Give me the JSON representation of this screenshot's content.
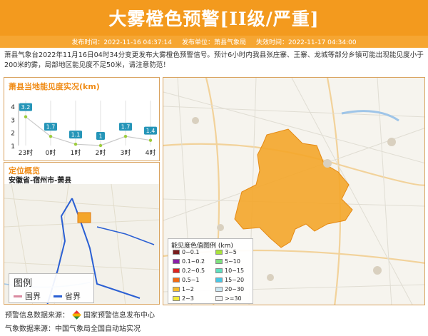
{
  "header": {
    "title": "大雾橙色预警[II级/严重]"
  },
  "meta": {
    "publish_time": "发布时间：2022-11-16 04:37:14",
    "publisher": "发布单位：萧县气象局",
    "expire_time": "失效时间：2022-11-17 04:34:00"
  },
  "intro": "萧县气象台2022年11月16日04时34分变更发布大雾橙色预警信号。预计6小时内我县张庄寨、王寨、龙城等部分乡镇可能出现能见度小于200米的雾，局部地区能见度不足50米，请注意防范！",
  "visibility": {
    "title": "萧县当地能见度实况(km)",
    "y_ticks": [
      "4",
      "3",
      "2",
      "1"
    ],
    "chart_data": {
      "type": "line",
      "categories": [
        "23时",
        "0时",
        "1时",
        "2时",
        "3时",
        "4时"
      ],
      "values": [
        3.2,
        1.7,
        1.1,
        1.0,
        1.7,
        1.4
      ],
      "labels": [
        "3.2",
        "1.7",
        "1.1",
        "1",
        "1.7",
        "1.4"
      ],
      "ylim": [
        1,
        4
      ],
      "line_color": "#c9c9c9",
      "point_color": "#9ccc3c",
      "label_color": "#2595b8"
    }
  },
  "location": {
    "title": "定位概览",
    "path": "安徽省-宿州市-萧县",
    "legend_title": "图例",
    "legend_country": "国界",
    "legend_province": "省界",
    "country_color": "#d98aa0",
    "province_color": "#2a5fd3"
  },
  "map_legend": {
    "title": "能见度色值图例 (km)",
    "items": [
      {
        "label": "0~0.1",
        "color": "#7a1c1c"
      },
      {
        "label": "3~5",
        "color": "#a8e33a"
      },
      {
        "label": "0.1~0.2",
        "color": "#8a1fa8"
      },
      {
        "label": "5~10",
        "color": "#7ee07e"
      },
      {
        "label": "0.2~0.5",
        "color": "#e0231f"
      },
      {
        "label": "10~15",
        "color": "#5fe0bf"
      },
      {
        "label": "0.5~1",
        "color": "#f36a13"
      },
      {
        "label": "15~20",
        "color": "#48c8e6"
      },
      {
        "label": "1~2",
        "color": "#f6bd2a"
      },
      {
        "label": "20~30",
        "color": "#c9e5f0"
      },
      {
        "label": "2~3",
        "color": "#f2ea3a"
      },
      {
        "label": ">=30",
        "color": "#f1f1f1"
      }
    ]
  },
  "sources": {
    "warning_label": "预警信息数据来源：",
    "warning_name": "国家预警信息发布中心",
    "weather_label": "气象数据来源：",
    "weather_name": "中国气象局全国自动站实况"
  },
  "colors": {
    "accent": "#f39a1e",
    "warning_area": "#f4a62a"
  }
}
